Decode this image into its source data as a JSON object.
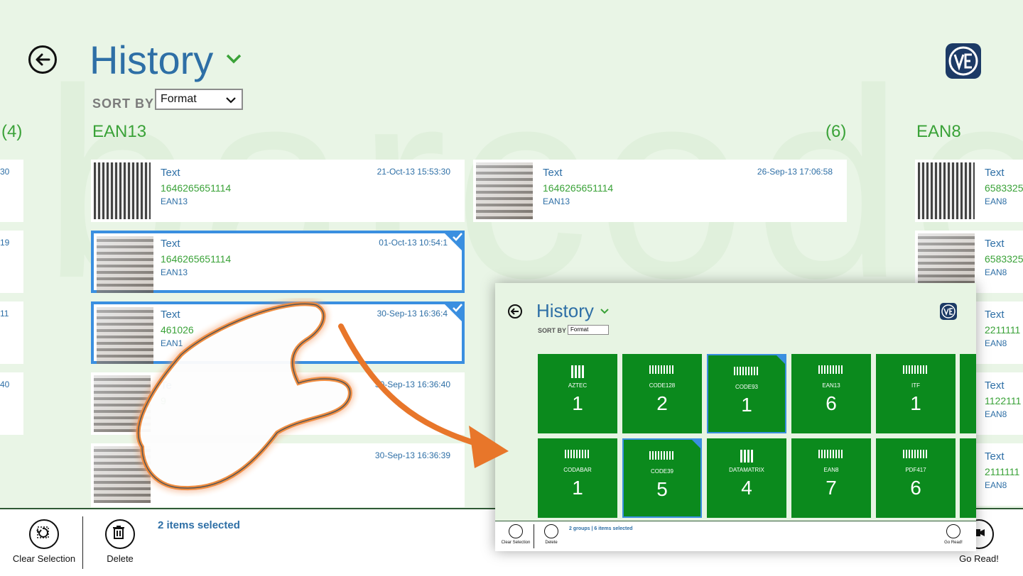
{
  "header": {
    "title": "History",
    "sort_by_label": "SORT BY",
    "sort_value": "Format"
  },
  "watermark": "barcode",
  "groups": {
    "left_count": "(4)",
    "main_name": "EAN13",
    "main_count": "(6)",
    "right_name": "EAN8"
  },
  "left_partial_numbers": [
    "30",
    "19",
    "11",
    "40"
  ],
  "cards": [
    {
      "type": "Text",
      "value": "1646265651114",
      "format": "EAN13",
      "date": "21-Oct-13 15:53:30"
    },
    {
      "type": "Text",
      "value": "1646265651114",
      "format": "EAN13",
      "date": "01-Oct-13 10:54:1"
    },
    {
      "type": "Text",
      "value": "461026",
      "format": "EAN1",
      "date": "30-Sep-13 16:36:4"
    },
    {
      "type": "Te",
      "value": "9",
      "format": "",
      "date": "30-Sep-13 16:36:40"
    },
    {
      "type": "",
      "value": "",
      "format": "",
      "date": "30-Sep-13 16:36:39"
    },
    {
      "type": "Text",
      "value": "1646265651114",
      "format": "EAN13",
      "date": "26-Sep-13 17:06:58"
    }
  ],
  "right_cards": [
    {
      "type": "Text",
      "value": "6583325",
      "format": "EAN8"
    },
    {
      "type": "Text",
      "value": "6583325",
      "format": "EAN8"
    },
    {
      "type": "Text",
      "value": "2211111",
      "format": "EAN8"
    },
    {
      "type": "Text",
      "value": "1122111",
      "format": "EAN8"
    },
    {
      "type": "Text",
      "value": "2111111",
      "format": "EAN8"
    }
  ],
  "app_bar": {
    "clear_selection": "Clear Selection",
    "delete": "Delete",
    "selected_text": "2 items selected",
    "go_read": "Go Read!"
  },
  "inset": {
    "title": "History",
    "sort_by_label": "SORT BY",
    "sort_value": "Format",
    "tiles": [
      {
        "label": "AZTEC",
        "count": "1",
        "icon": "qr"
      },
      {
        "label": "CODE128",
        "count": "2",
        "icon": "bar"
      },
      {
        "label": "CODE93",
        "count": "1",
        "icon": "bar",
        "selected": true
      },
      {
        "label": "EAN13",
        "count": "6",
        "icon": "bar"
      },
      {
        "label": "ITF",
        "count": "1",
        "icon": "bar"
      },
      {
        "label": "CODABAR",
        "count": "1",
        "icon": "bar"
      },
      {
        "label": "CODE39",
        "count": "5",
        "icon": "bar",
        "selected": true
      },
      {
        "label": "DATAMATRIX",
        "count": "4",
        "icon": "qr"
      },
      {
        "label": "EAN8",
        "count": "7",
        "icon": "bar"
      },
      {
        "label": "PDF417",
        "count": "6",
        "icon": "bar"
      }
    ],
    "app_bar": {
      "clear_selection": "Clear Selection",
      "delete": "Delete",
      "selected_text": "2 groups | 6 items selected",
      "go_read": "Go Read!"
    }
  },
  "colors": {
    "background": "#e9f5e6",
    "title_blue": "#2e6fa6",
    "group_green": "#3aa238",
    "tile_green": "#0b8a1d",
    "selection_blue": "#3a8fe0",
    "hand_glow": "#f08a3a",
    "arrow_orange": "#e8762a"
  }
}
